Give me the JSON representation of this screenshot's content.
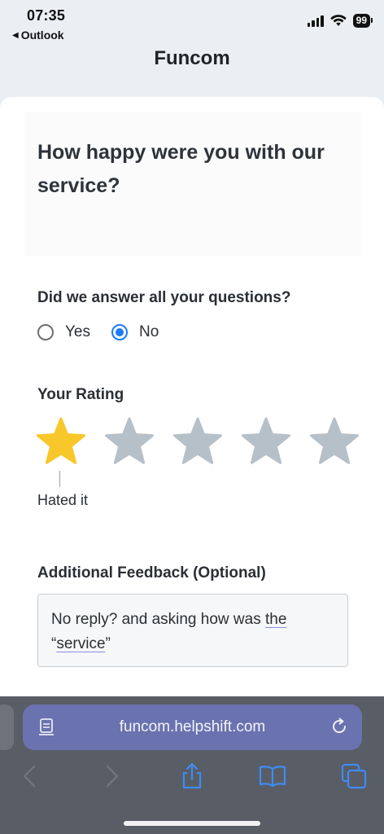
{
  "status_bar": {
    "time": "07:35",
    "back_app": "Outlook",
    "battery": "99"
  },
  "header": {
    "title": "Funcom"
  },
  "survey": {
    "question": "How happy were you with our service?",
    "answered_label": "Did we answer all your questions?",
    "options": [
      {
        "label": "Yes",
        "selected": false
      },
      {
        "label": "No",
        "selected": true
      }
    ],
    "rating_label": "Your Rating",
    "rating": 1,
    "rating_max": 5,
    "rating_caption": "Hated it",
    "feedback_label": "Additional Feedback (Optional)",
    "feedback_text": {
      "part1": "No reply? and asking how was ",
      "part2": "the",
      "part3": "“",
      "part4": "service",
      "part5": "”"
    }
  },
  "browser": {
    "url": "funcom.helpshift.com"
  },
  "colors": {
    "star_active": "#f8c72a",
    "star_inactive": "#b6c0c9",
    "radio_selected": "#1a7cf7",
    "url_bar": "#6a72b0"
  }
}
